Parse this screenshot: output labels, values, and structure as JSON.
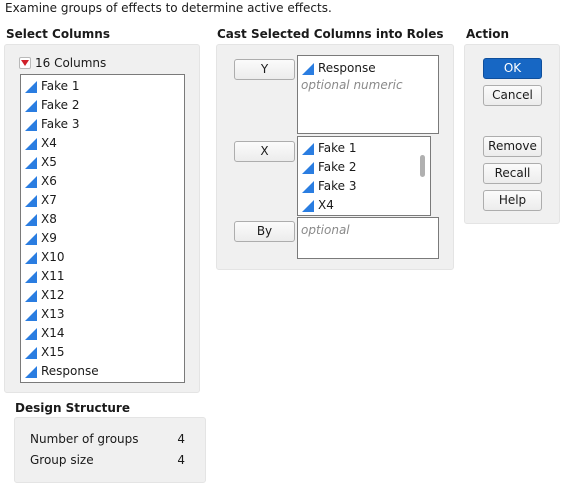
{
  "instruction": "Examine groups of effects to determine active effects.",
  "select_columns": {
    "heading": "Select Columns",
    "count_label": "16 Columns",
    "items": [
      "Fake 1",
      "Fake 2",
      "Fake 3",
      "X4",
      "X5",
      "X6",
      "X7",
      "X8",
      "X9",
      "X10",
      "X11",
      "X12",
      "X13",
      "X14",
      "X15",
      "Response"
    ]
  },
  "cast_roles": {
    "heading": "Cast Selected Columns into Roles",
    "y": {
      "button": "Y",
      "items": [
        "Response"
      ],
      "placeholder": "optional numeric"
    },
    "x": {
      "button": "X",
      "items": [
        "Fake 1",
        "Fake 2",
        "Fake 3",
        "X4"
      ]
    },
    "by": {
      "button": "By",
      "placeholder": "optional"
    }
  },
  "action": {
    "heading": "Action",
    "ok": "OK",
    "cancel": "Cancel",
    "remove": "Remove",
    "recall": "Recall",
    "help": "Help"
  },
  "design_structure": {
    "heading": "Design Structure",
    "rows": [
      {
        "label": "Number of groups",
        "value": "4"
      },
      {
        "label": "Group size",
        "value": "4"
      }
    ]
  },
  "colors": {
    "continuous_icon": "#2a7de1",
    "primary_button": "#1767c4",
    "dropdown_arrow": "#d0202a"
  },
  "icons": {
    "column_type": "continuous-triangle-icon",
    "dropdown": "red-triangle-menu-icon"
  }
}
